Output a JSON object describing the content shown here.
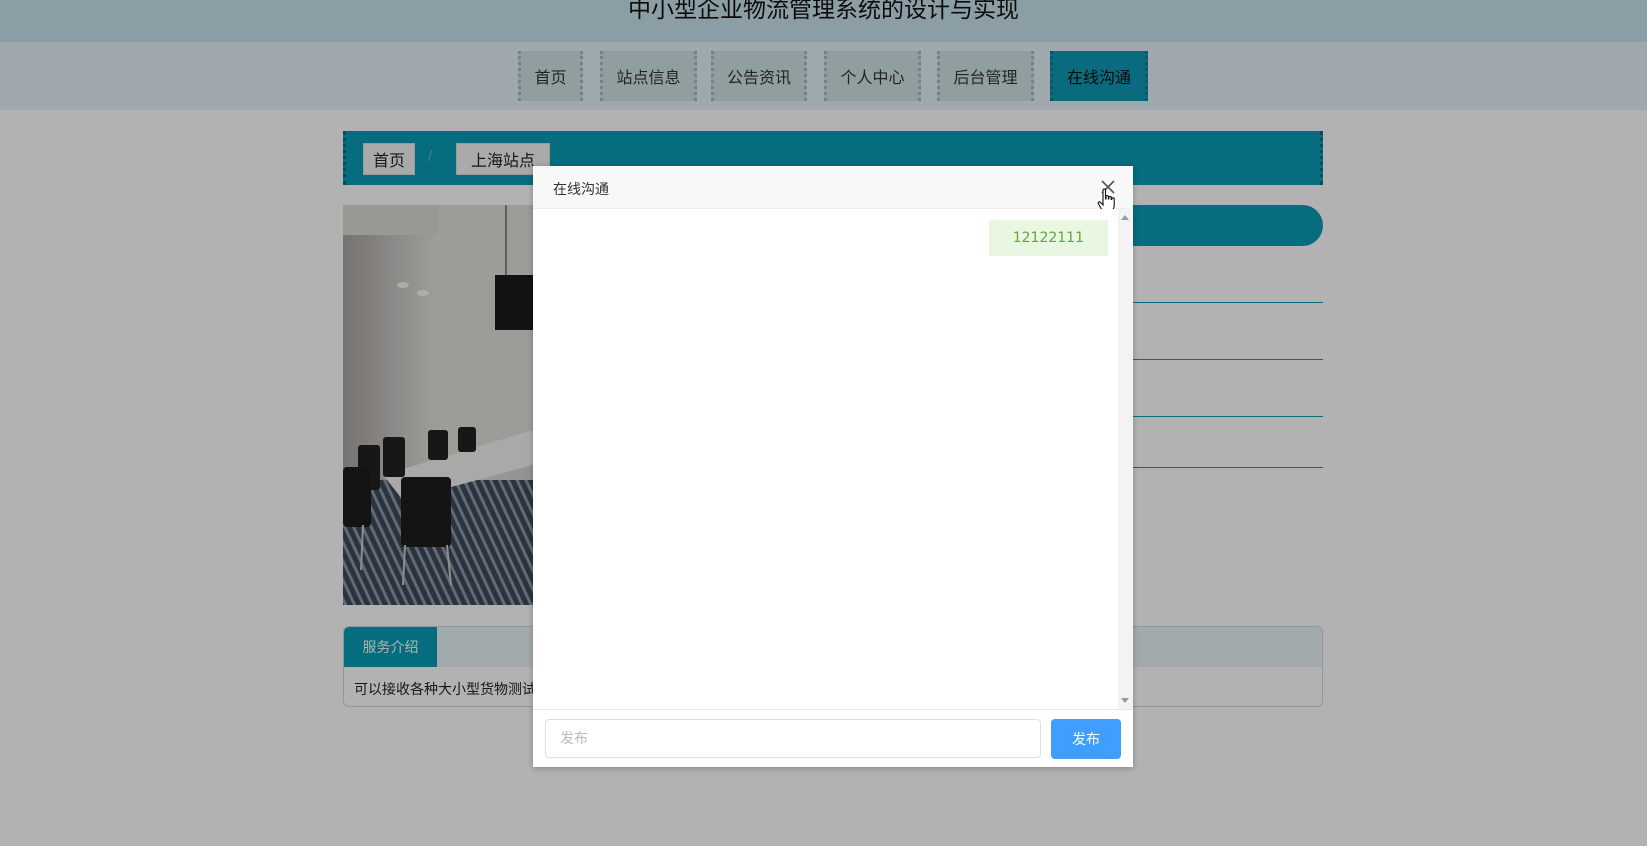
{
  "site": {
    "title": "中小型企业物流管理系统的设计与实现"
  },
  "nav": {
    "items": [
      {
        "label": "首页"
      },
      {
        "label": "站点信息"
      },
      {
        "label": "公告资讯"
      },
      {
        "label": "个人中心"
      },
      {
        "label": "后台管理"
      },
      {
        "label": "在线沟通",
        "active": true
      }
    ]
  },
  "breadcrumb": {
    "home": "首页",
    "separator": "/",
    "current": "上海站点"
  },
  "service": {
    "tab_label": "服务介绍",
    "text": "可以接收各种大小型货物测试"
  },
  "chat": {
    "title": "在线沟通",
    "messages": [
      {
        "text": "12122111",
        "side": "right"
      }
    ],
    "input_placeholder": "发布",
    "send_label": "发布"
  },
  "colors": {
    "accent": "#0a9cb5",
    "send_button": "#409eff",
    "bubble_bg": "#e9f6e1",
    "bubble_text": "#5da83a"
  },
  "icons": {
    "close": "close-icon",
    "cursor": "hand-cursor-icon",
    "scroll_up": "scroll-up-icon",
    "scroll_down": "scroll-down-icon"
  }
}
